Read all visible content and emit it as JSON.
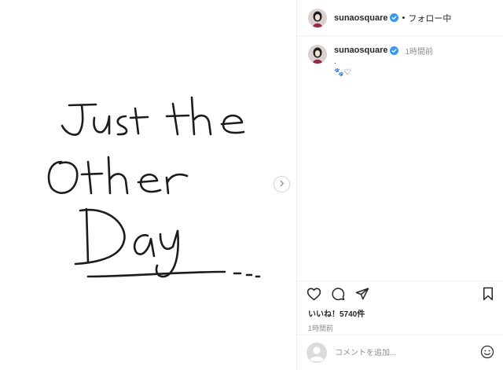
{
  "post": {
    "username": "sunaosquare",
    "follow_label": "フォロー中",
    "dot": "•",
    "comment_username": "sunaosquare",
    "comment_time": "1時間前",
    "caption_line1": ".",
    "caption_line2": "🐾♡",
    "likes": "いいね！5740件",
    "posted_time": "1時間前",
    "comment_placeholder": "コメントを追加...",
    "image_handwriting": [
      "Just the",
      "Other",
      "Day..."
    ]
  },
  "icons": {
    "verified": "verified-badge-icon",
    "next": "chevron-right-icon",
    "like": "heart-icon",
    "comment": "comment-bubble-icon",
    "share": "paper-plane-icon",
    "save": "bookmark-icon",
    "emoji": "emoji-icon",
    "avatar_default": "default-avatar-icon"
  },
  "colors": {
    "verified_blue": "#3897f0",
    "muted_text": "#8e8e8e",
    "text": "#262626",
    "divider": "#efefef",
    "avatar_bg": "#d9d2cf",
    "avatar_outfit": "#9b2640"
  }
}
